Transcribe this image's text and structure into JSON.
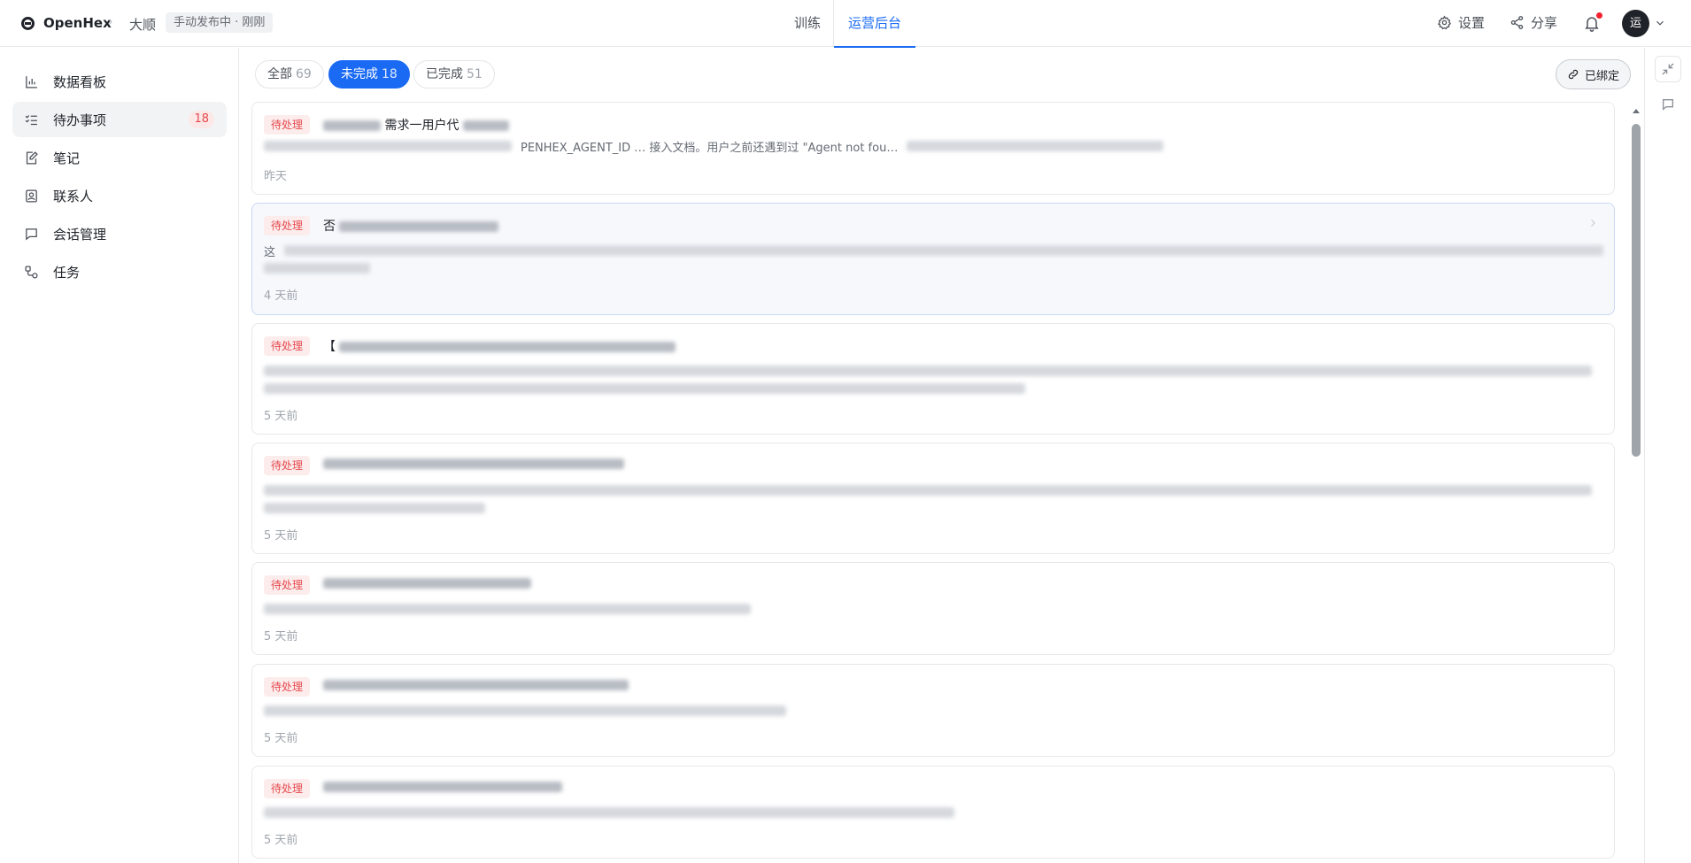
{
  "header": {
    "app_name": "OpenHex",
    "crumb_separator": "›",
    "project": "大顺",
    "publish_status": "手动发布中 · 刚刚",
    "tabs": [
      {
        "label": "训练",
        "active": false
      },
      {
        "label": "运营后台",
        "active": true
      }
    ],
    "settings_label": "设置",
    "share_label": "分享",
    "has_notification": true,
    "avatar_text": "运"
  },
  "sidebar": {
    "items": [
      {
        "label": "数据看板",
        "icon": "bar-chart-icon",
        "active": false
      },
      {
        "label": "待办事项",
        "icon": "checklist-icon",
        "active": true,
        "count": "18"
      },
      {
        "label": "笔记",
        "icon": "edit-note-icon",
        "active": false
      },
      {
        "label": "联系人",
        "icon": "contact-card-icon",
        "active": false
      },
      {
        "label": "会话管理",
        "icon": "chat-bubble-icon",
        "active": false
      },
      {
        "label": "任务",
        "icon": "workflow-icon",
        "active": false
      }
    ]
  },
  "filters": [
    {
      "label": "全部",
      "count": "69",
      "active": false
    },
    {
      "label": "未完成",
      "count": "18",
      "active": true
    },
    {
      "label": "已完成",
      "count": "51",
      "active": false
    }
  ],
  "bound_label": "已绑定",
  "todos": [
    {
      "status": "待处理",
      "title": "需求一用户代",
      "desc": "PENHEX_AGENT_ID … 接入文档。用户之前还遇到过 \"Agent not fou…",
      "time": "昨天"
    },
    {
      "status": "待处理",
      "title": "否",
      "desc": "这",
      "time": "4 天前"
    },
    {
      "status": "待处理",
      "title": "【",
      "desc": "",
      "time": "5 天前"
    },
    {
      "status": "待处理",
      "title": "",
      "desc": "",
      "time": "5 天前"
    },
    {
      "status": "待处理",
      "title": "",
      "desc": "",
      "time": "5 天前"
    },
    {
      "status": "待处理",
      "title": "",
      "desc": "",
      "time": "5 天前"
    },
    {
      "status": "待处理",
      "title": "",
      "desc": "",
      "time": "5 天前"
    }
  ],
  "colors": {
    "accent": "#1a6af4",
    "pending_tag_bg": "#fdecec",
    "pending_tag_text": "#e5484d"
  }
}
